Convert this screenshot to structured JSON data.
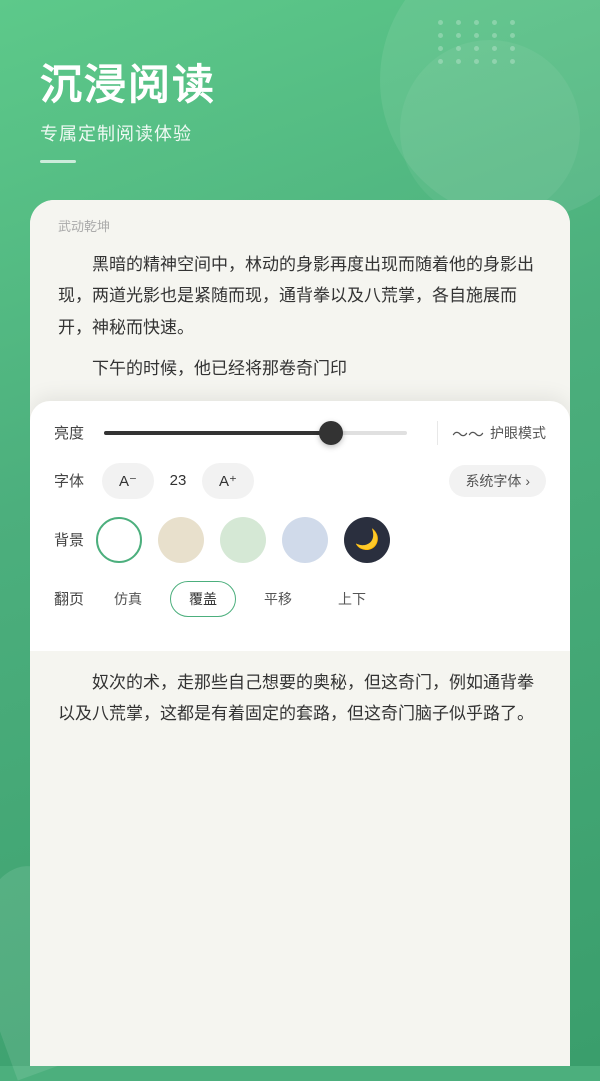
{
  "hero": {
    "title": "沉浸阅读",
    "subtitle": "专属定制阅读体验"
  },
  "book": {
    "title": "武动乾坤",
    "para1": "黑暗的精神空间中，林动的身影再度出现而随着他的身影出现，两道光影也是紧随而现，通背拳以及八荒掌，各自施展而开，神秘而快速。",
    "para2": "下午的时候，他已经将那卷奇门印",
    "para3": "奴次的术，走那些自己想要的奥秘，但这奇门，例如通背拳以及八荒掌，这都是有着固定的套路，但这奇门脑子似乎路了。"
  },
  "settings": {
    "brightness_label": "亮度",
    "brightness_value": 75,
    "eye_mode_label": "护眼模式",
    "font_label": "字体",
    "font_decrease": "A⁻",
    "font_size": "23",
    "font_increase": "A⁺",
    "font_family": "系统字体 ›",
    "bg_label": "背景",
    "pageturn_label": "翻页",
    "pageturn_options": [
      "仿真",
      "覆盖",
      "平移",
      "上下"
    ],
    "pageturn_active": "覆盖"
  },
  "icons": {
    "eye": "〜",
    "chevron": "›"
  }
}
